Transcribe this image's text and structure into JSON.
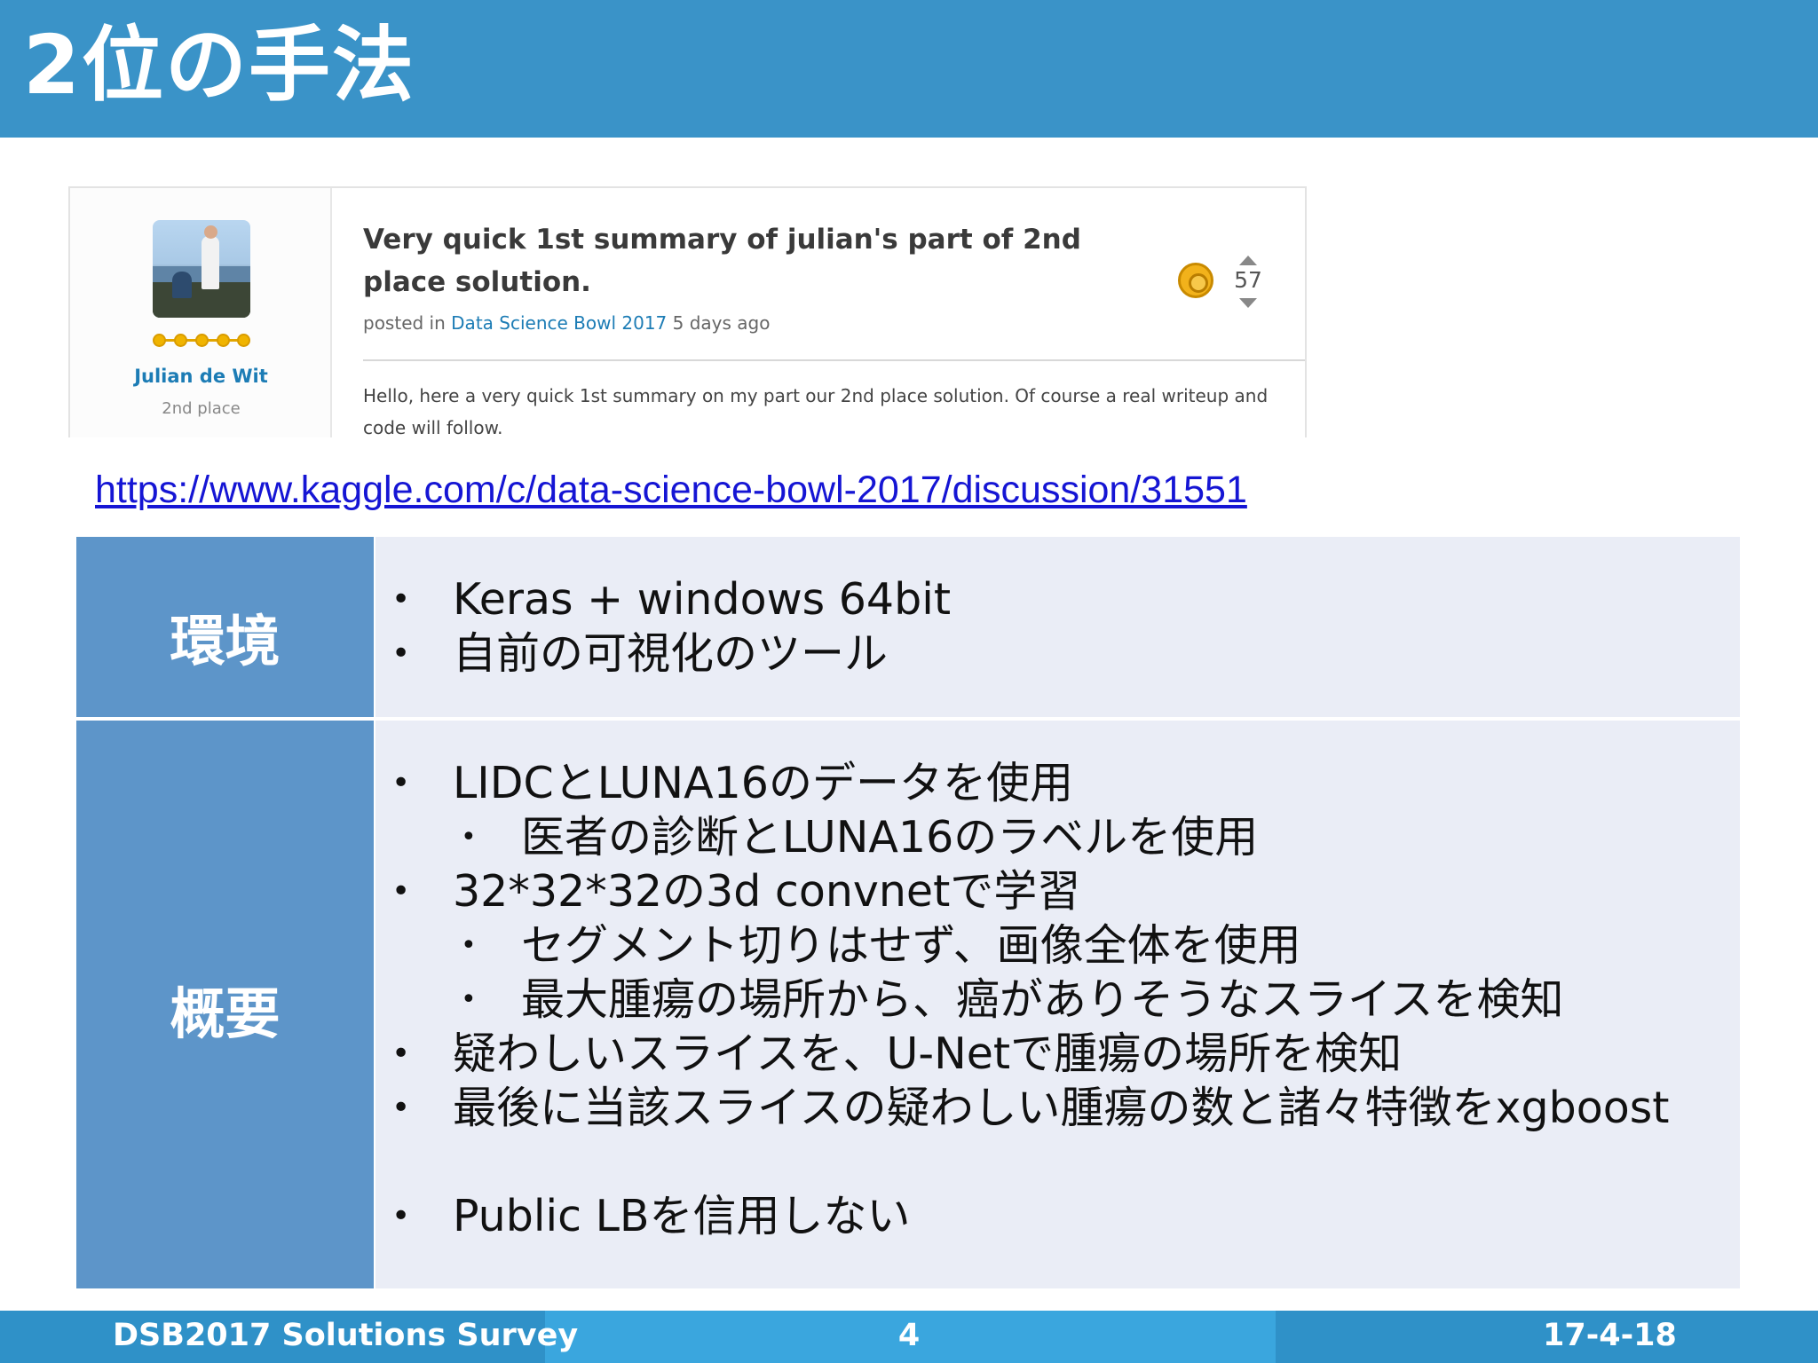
{
  "slide": {
    "title": "2位の手法"
  },
  "post": {
    "user_name": "Julian de Wit",
    "user_rank": "2nd place",
    "title": "Very quick 1st summary of julian's part of 2nd place solution.",
    "meta_prefix": "posted in",
    "meta_link": "Data Science Bowl 2017",
    "meta_suffix": "5 days ago",
    "votes": "57",
    "body": "Hello, here a very quick 1st summary on my part our 2nd place solution. Of course a real writeup and code will follow."
  },
  "url": "https://www.kaggle.com/c/data-science-bowl-2017/discussion/31551",
  "table": {
    "env_label": "環境",
    "env_items": [
      "Keras + windows 64bit",
      "自前の可視化のツール"
    ],
    "summary_label": "概要",
    "summary_items": [
      "LIDCとLUNA16のデータを使用",
      "医者の診断とLUNA16のラベルを使用",
      "32*32*32の3d convnetで学習",
      "セグメント切りはせず、画像全体を使用",
      "最大腫瘍の場所から、癌がありそうなスライスを検知",
      "疑わしいスライスを、U-Netで腫瘍の場所を検知",
      "最後に当該スライスの疑わしい腫瘍の数と諸々特徴をxgboost",
      "Public LBを信用しない"
    ]
  },
  "footer": {
    "left": "DSB2017 Solutions Survey",
    "page": "4",
    "date": "17-4-18"
  },
  "colors": {
    "header_bg": "#3a93c8",
    "label_cell": "#5d95c9",
    "content_cell": "#eaedf6",
    "link": "#1515d4",
    "footer_bg": "#3aa6de"
  }
}
